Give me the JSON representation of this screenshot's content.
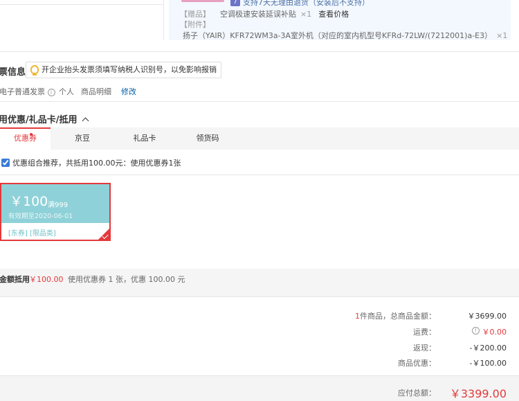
{
  "product": {
    "return_policy": "支持7天无理由退货（安装后不支持）",
    "return_badge": "7",
    "gift": {
      "tag": "【赠品】",
      "name": "空调极速安装延误补贴",
      "qty": "×1",
      "check_price": "查看价格"
    },
    "attachment": {
      "tag": "【附件】",
      "name": "扬子（YAIR）KFR72WM3a-3A室外机（对应的室内机型号KFRd-72LW/(7212001)a-E3）",
      "qty": "×1"
    }
  },
  "invoice": {
    "title": "票信息",
    "tip": "开企业抬头发票须填写纳税人识别号，以免影响报销",
    "type": "电子普通发票",
    "info_icon": "i",
    "header": "个人",
    "content": "商品明细",
    "modify": "修改"
  },
  "discount": {
    "title": "用优惠/礼品卡/抵用",
    "tabs": [
      {
        "label": "优惠券"
      },
      {
        "label": "京豆"
      },
      {
        "label": "礼品卡"
      },
      {
        "label": "领货码"
      }
    ],
    "combo_text": "优惠组合推荐，共抵用100.00元：使用优惠券1张",
    "coupon": {
      "amount": "￥100",
      "condition": "满999",
      "expiry": "有效期至2020-06-01",
      "tags": "[东券]  [限品类]"
    },
    "used_label": "金额抵用",
    "used_amount": "￥100.00",
    "used_desc": "使用优惠券 1 张，优惠 100.00 元"
  },
  "summary": {
    "count": "1",
    "count_label": "件商品，总商品金额：",
    "total": "￥3699.00",
    "shipping_label": "运费：",
    "shipping_info_icon": "!",
    "shipping": "￥0.00",
    "rebate_label": "返现：",
    "rebate": "-￥200.00",
    "discount_label": "商品优惠：",
    "discount": "-￥100.00",
    "payable_label": "应付总额：",
    "payable": "￥3399.00"
  },
  "colors": {
    "accent": "#e4393c",
    "link": "#005ea7",
    "coupon": "#8fd1d8"
  }
}
